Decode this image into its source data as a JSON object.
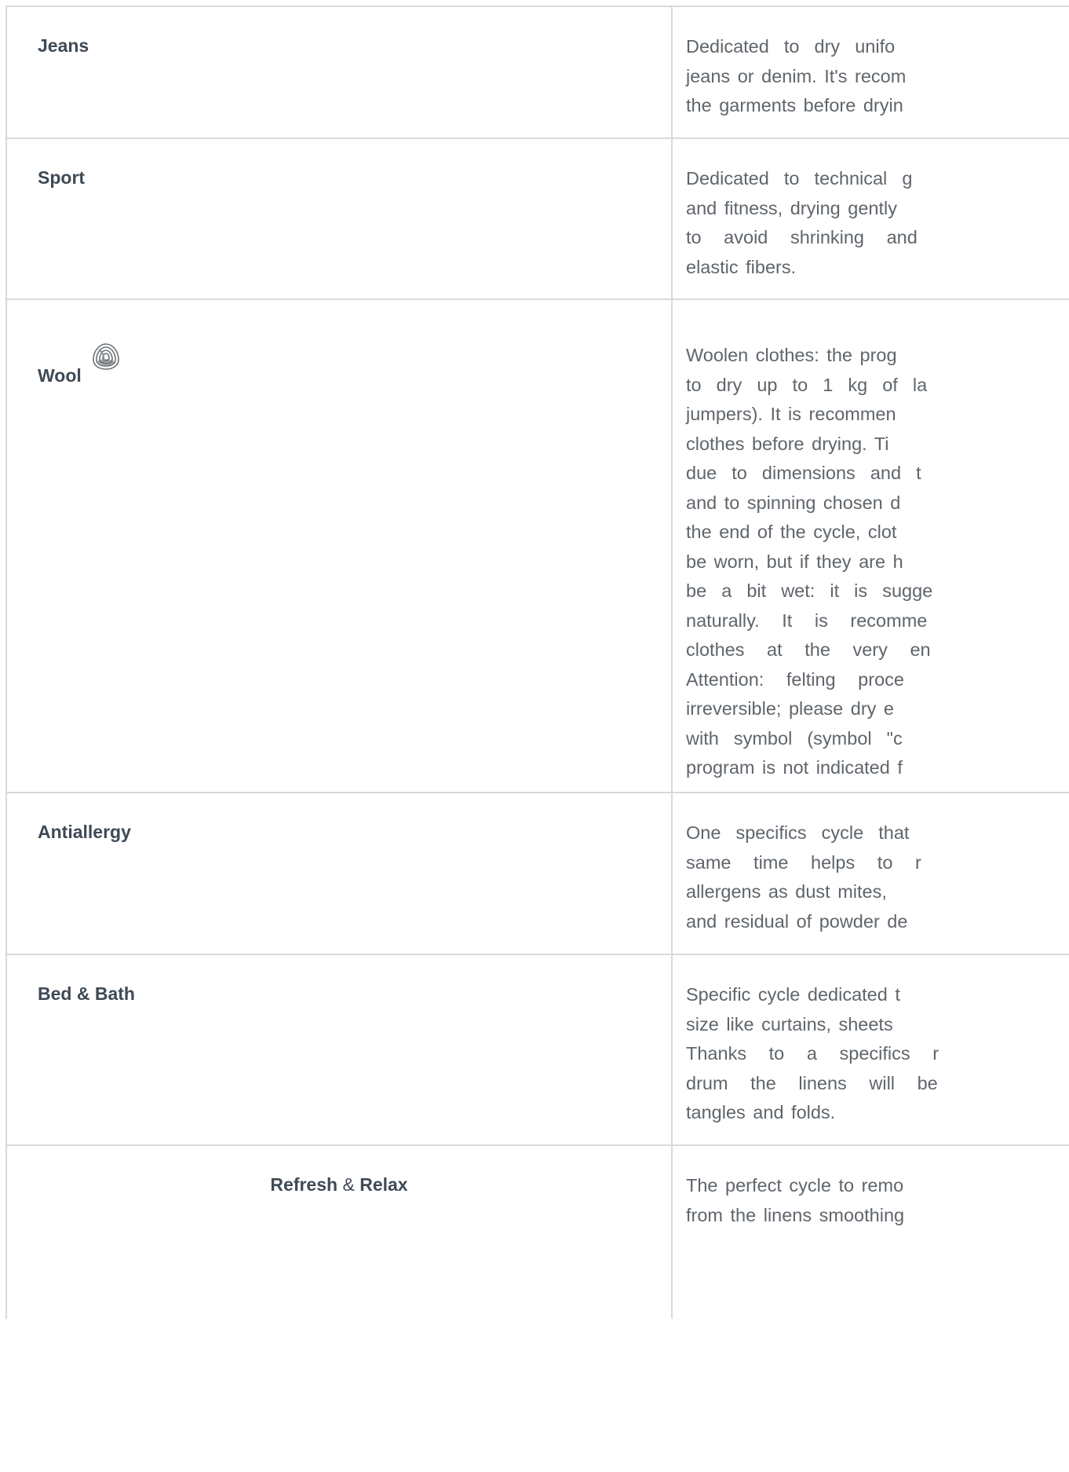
{
  "rows": [
    {
      "name": "Jeans",
      "lines": [
        "Dedicated  to  dry  unifo",
        "jeans or denim. It's recom",
        "the garments before dryin"
      ]
    },
    {
      "name": "Sport",
      "lines": [
        "Dedicated  to  technical  g",
        "and fitness, drying gently",
        "to   avoid   shrinking   and",
        "elastic fibers."
      ]
    },
    {
      "name": "Wool",
      "icon": "wool-mark-icon",
      "lines": [
        "Woolen clothes: the prog",
        "to  dry  up  to  1  kg  of  la",
        "jumpers). It is recommen",
        "clothes before drying. Ti",
        "due  to  dimensions  and  t",
        "and to spinning chosen d",
        "the end of the cycle, clot",
        "be worn, but if they are h",
        "be  a  bit  wet:  it  is  sugge",
        "naturally.   It   is   recomme",
        "clothes   at   the   very   en",
        "Attention:   felting   proce",
        "irreversible; please dry e",
        "with  symbol  (symbol  \"c",
        "program is not indicated f"
      ]
    },
    {
      "name": "Antiallergy",
      "lines": [
        "One  specifics  cycle  that",
        "same   time   helps   to   r",
        "allergens as dust mites,",
        "and residual of powder de"
      ]
    },
    {
      "name": "Bed & Bath",
      "lines": [
        "Specific cycle dedicated t",
        "size like curtains, sheets",
        "Thanks   to   a   specifics   r",
        "drum   the   linens   will   be",
        "tangles and folds."
      ]
    },
    {
      "name_part1": "Refresh",
      "name_joiner": "&",
      "name_part2": "Relax",
      "lines": [
        "The perfect cycle to remo",
        "from the linens smoothing"
      ]
    }
  ]
}
